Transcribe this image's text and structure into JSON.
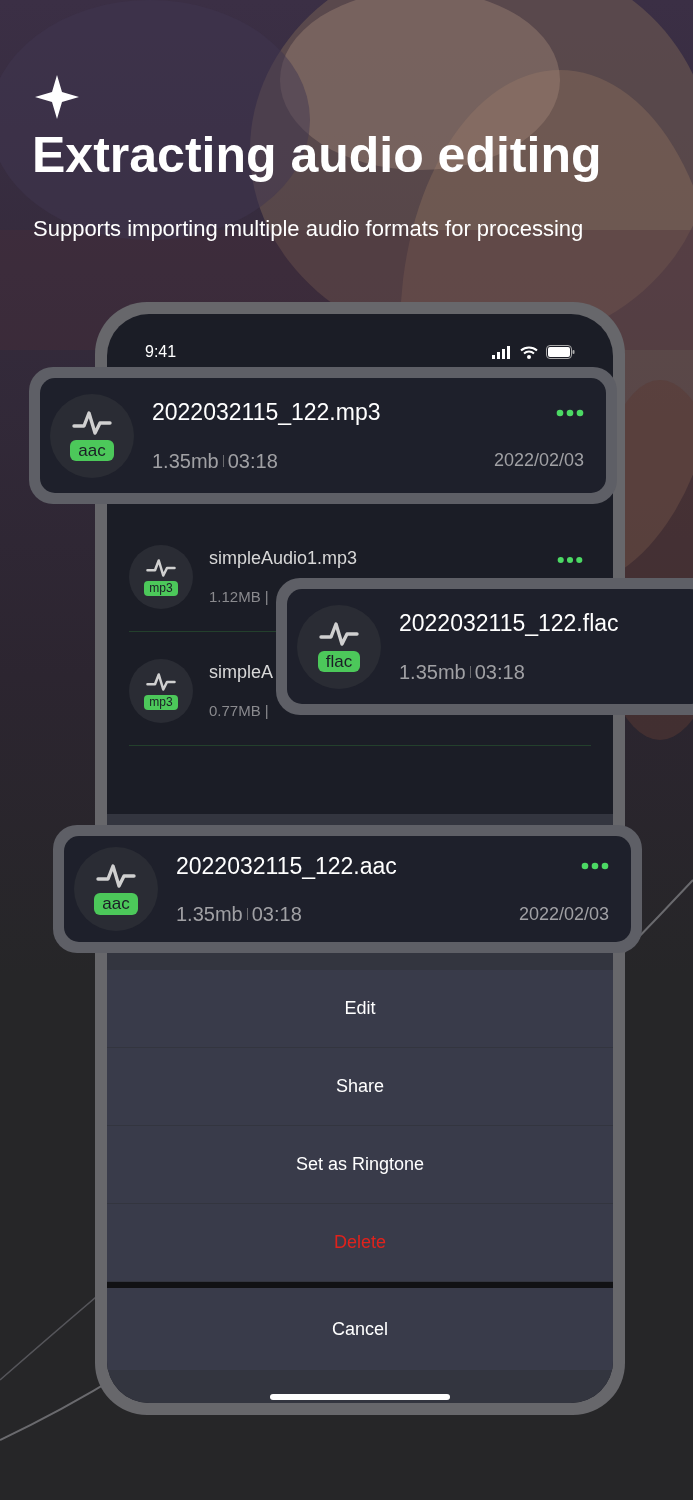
{
  "header": {
    "title": "Extracting audio editing",
    "subtitle": "Supports importing multiple audio formats for processing"
  },
  "status_bar": {
    "time": "9:41"
  },
  "list": [
    {
      "name": "simpleAudio1.mp3",
      "format": "mp3",
      "meta": "1.12MB |",
      "has_menu": true
    },
    {
      "name": "simpleA",
      "format": "mp3",
      "meta": "0.77MB |",
      "has_menu": false
    }
  ],
  "floating_cards": [
    {
      "name": "2022032115_122.mp3",
      "format": "aac",
      "size": "1.35mb",
      "duration": "03:18",
      "date": "2022/02/03",
      "has_menu": true
    },
    {
      "name": "2022032115_122.flac",
      "format": "flac",
      "size": "1.35mb",
      "duration": "03:18",
      "has_menu": false
    },
    {
      "name": "2022032115_122.aac",
      "format": "aac",
      "size": "1.35mb",
      "duration": "03:18",
      "date": "2022/02/03",
      "has_menu": true
    }
  ],
  "action_sheet": {
    "items": [
      {
        "label": "Edit",
        "kind": "normal"
      },
      {
        "label": "Share",
        "kind": "normal"
      },
      {
        "label": "Set as Ringtone",
        "kind": "normal"
      },
      {
        "label": "Delete",
        "kind": "destructive"
      }
    ],
    "cancel": "Cancel"
  }
}
